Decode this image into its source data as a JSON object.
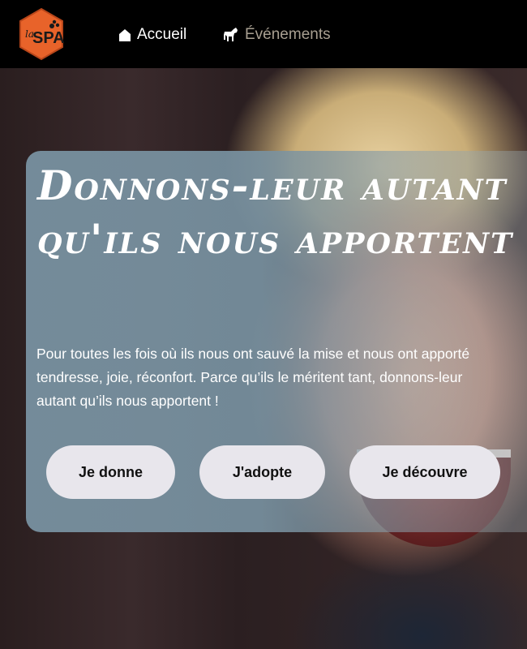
{
  "logo": {
    "text": "la SPA",
    "color": "#e8632a"
  },
  "nav": {
    "home": {
      "label": "Accueil",
      "icon": "home-icon",
      "color": "#ffffff"
    },
    "events": {
      "label": "Événements",
      "icon": "dog-icon",
      "color": "#a89f91"
    }
  },
  "hero": {
    "title_line1": "Donnons-leur autant",
    "title_line2": "qu'ils nous apportent",
    "text_line1": "Pour toutes les fois où ils nous ont sauvé la mise et nous ont apporté",
    "text_line2": "tendresse, joie, réconfort. Parce qu’ils le méritent tant, donnons-leur",
    "text_line3": "autant qu’ils nous apportent !",
    "buttons": {
      "donate": "Je donne",
      "adopt": "J'adopte",
      "discover": "Je découvre"
    }
  }
}
